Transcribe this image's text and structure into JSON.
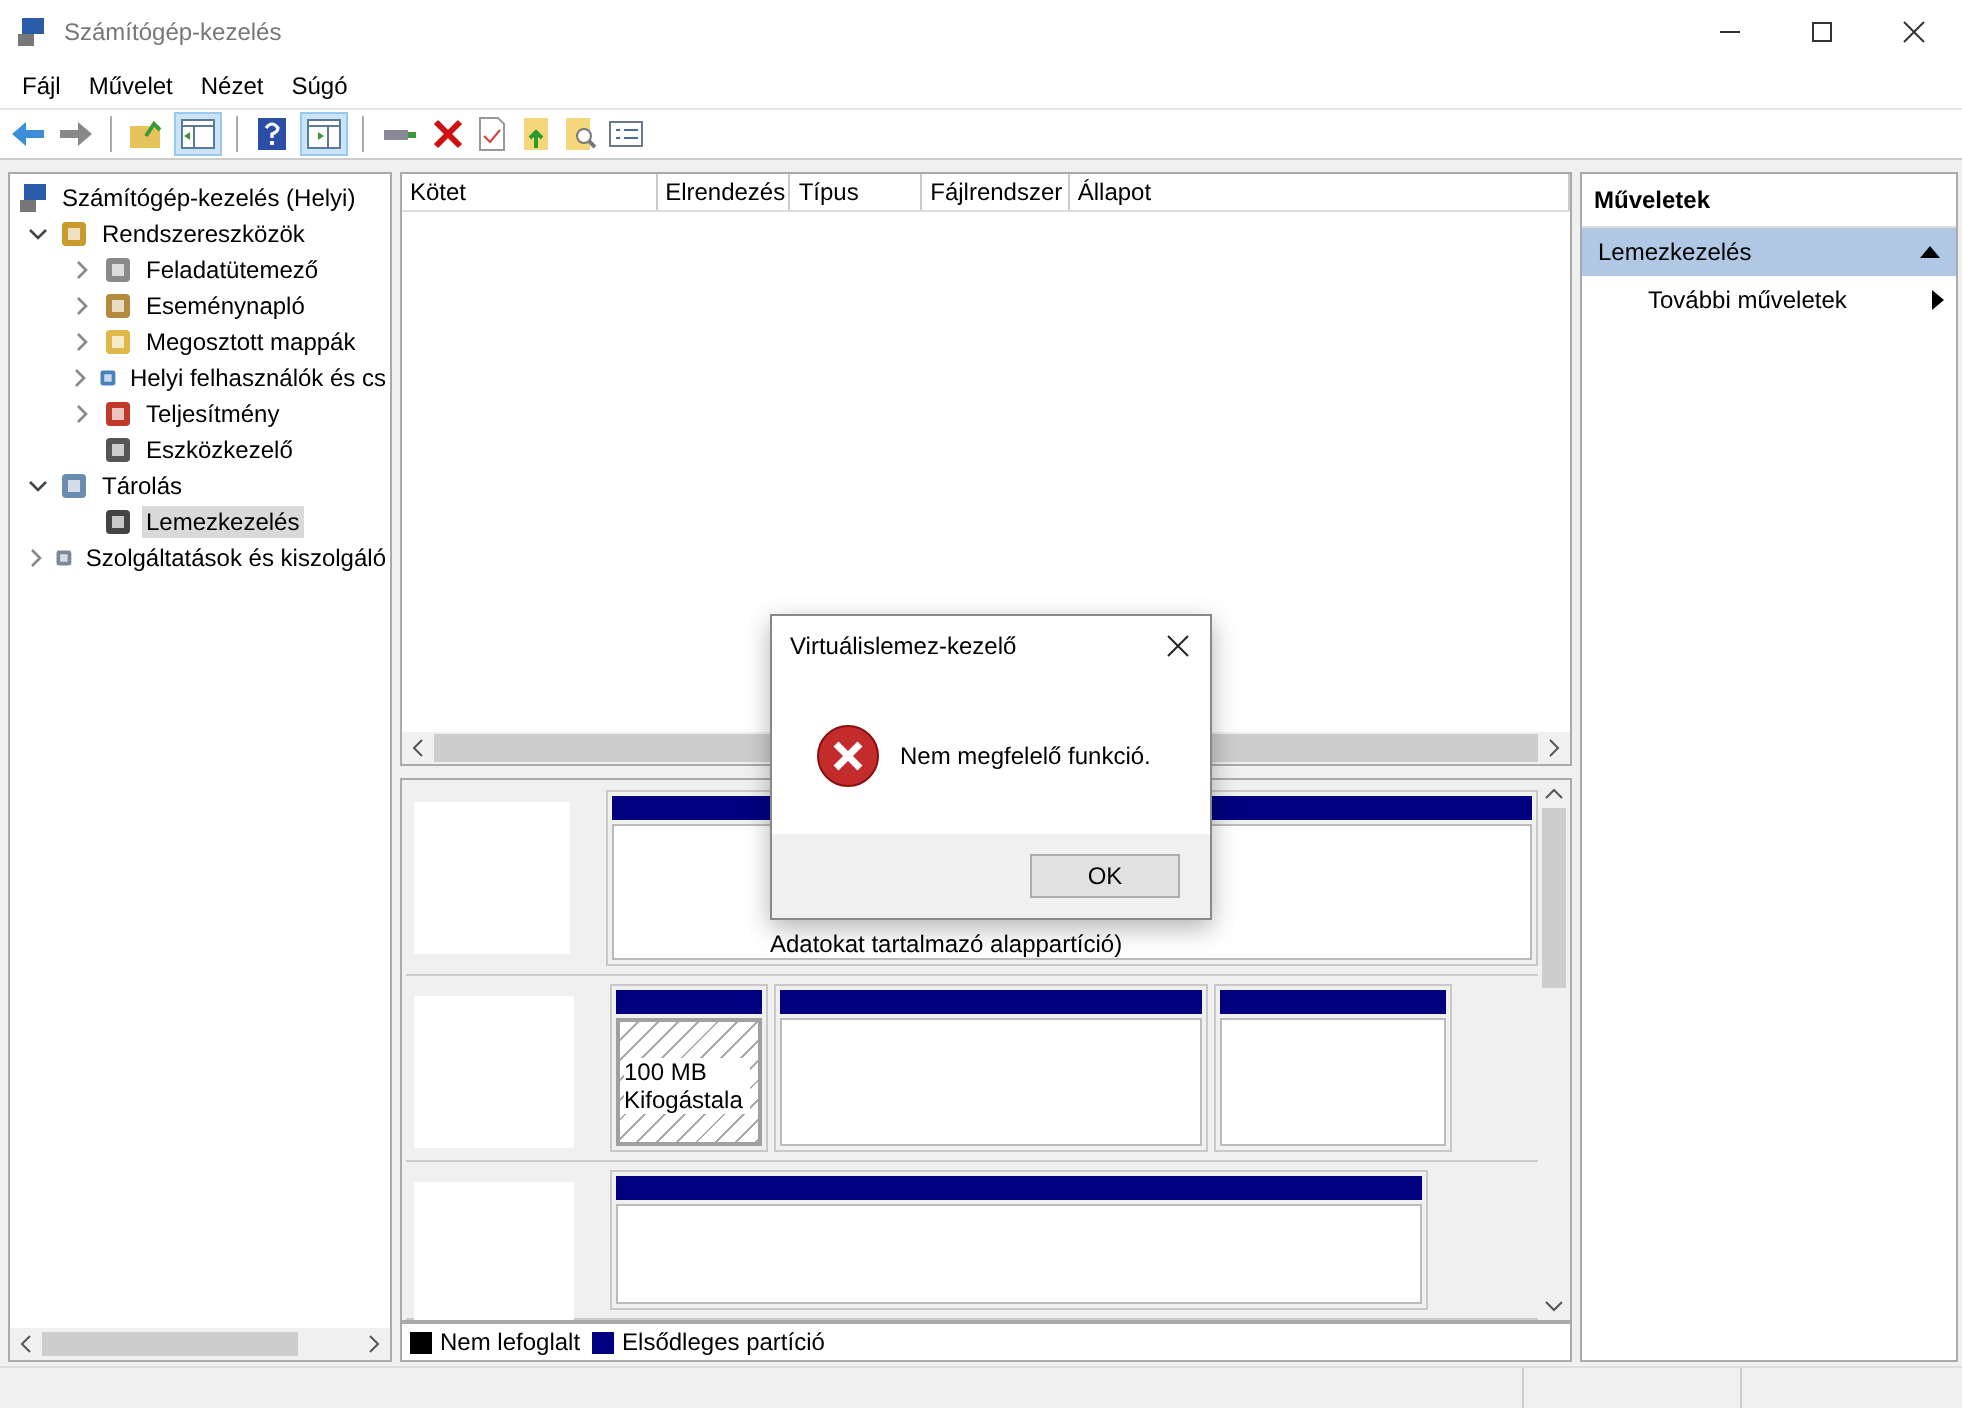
{
  "window": {
    "title": "Számítógép-kezelés"
  },
  "menu": [
    "Fájl",
    "Művelet",
    "Nézet",
    "Súgó"
  ],
  "toolbar": {
    "console_tree_on": true,
    "action_pane_on": true
  },
  "tree": {
    "label": "Számítógép-kezelés (Helyi)",
    "children": [
      {
        "label": "Rendszereszközök",
        "expandable": true,
        "expanded": true,
        "selected": false,
        "children": [
          {
            "label": "Feladatütemező",
            "expandable": true,
            "expanded": false,
            "selected": false
          },
          {
            "label": "Eseménynapló",
            "expandable": true,
            "expanded": false,
            "selected": false
          },
          {
            "label": "Megosztott mappák",
            "expandable": true,
            "expanded": false,
            "selected": false
          },
          {
            "label": "Helyi felhasználók és cs",
            "expandable": true,
            "expanded": false,
            "selected": false
          },
          {
            "label": "Teljesítmény",
            "expandable": true,
            "expanded": false,
            "selected": false
          },
          {
            "label": "Eszközkezelő",
            "expandable": false,
            "expanded": false,
            "selected": false
          }
        ]
      },
      {
        "label": "Tárolás",
        "expandable": true,
        "expanded": true,
        "selected": false,
        "children": [
          {
            "label": "Lemezkezelés",
            "expandable": false,
            "expanded": false,
            "selected": true
          }
        ]
      },
      {
        "label": "Szolgáltatások és kiszolgáló",
        "expandable": true,
        "expanded": false,
        "selected": false
      }
    ]
  },
  "volume_table": {
    "columns": [
      "Kötet",
      "Elrendezés",
      "Típus",
      "Fájlrendszer",
      "Állapot"
    ]
  },
  "disks": [
    {
      "partitions": [
        {
          "kind": "primary",
          "lines": [
            "Adatokat tartalmazó alappartíció)"
          ]
        }
      ]
    },
    {
      "partitions": [
        {
          "kind": "hatched",
          "lines": [
            "100 MB",
            "Kifogástala"
          ]
        },
        {
          "kind": "primary"
        },
        {
          "kind": "primary"
        }
      ]
    },
    {
      "partitions": [
        {
          "kind": "primary"
        }
      ]
    }
  ],
  "legend": [
    {
      "label": "Nem lefoglalt",
      "color": "#000000"
    },
    {
      "label": "Elsődleges partíció",
      "color": "#000080"
    }
  ],
  "actions": {
    "title": "Műveletek",
    "section": {
      "label": "Lemezkezelés",
      "expanded": true,
      "items": [
        "További műveletek"
      ]
    }
  },
  "dialog": {
    "title": "Virtuálislemez-kezelő",
    "message": "Nem megfelelő funkció.",
    "button": "OK"
  }
}
